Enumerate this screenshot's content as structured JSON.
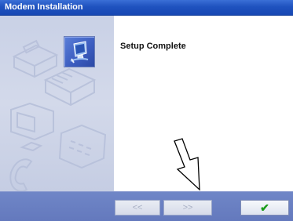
{
  "window": {
    "title": "Modem Installation"
  },
  "content": {
    "heading": "Setup Complete"
  },
  "footer": {
    "back_label": "<<",
    "next_label": ">>",
    "finish_label": "✔"
  },
  "icons": {
    "app": "computer-setup-icon",
    "decor": [
      "printer-icon",
      "fax-machine-icon",
      "monitor-icon",
      "telephone-icon"
    ],
    "pointer": "down-arrow-icon"
  },
  "colors": {
    "title_bar": "#1f52bf",
    "footer": "#6479bd",
    "finish_check": "#1a9c1a"
  }
}
